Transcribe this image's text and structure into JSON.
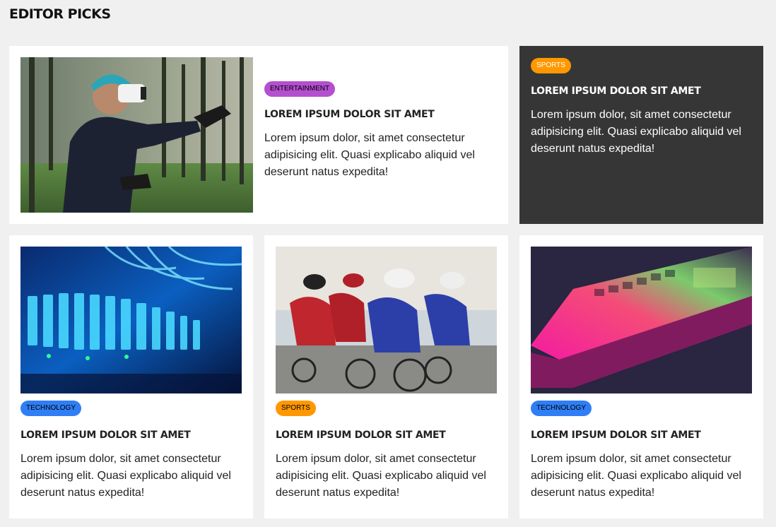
{
  "section": {
    "title": "EDITOR PICKS"
  },
  "colors": {
    "entertainment": "#b44fd0",
    "sports": "#ff9800",
    "technology": "#2f7ef5",
    "dark_card": "#363636"
  },
  "cards": [
    {
      "category": "ENTERTAINMENT",
      "badge_color": "#b44fd0",
      "title": "LOREM IPSUM DOLOR SIT AMET",
      "text": "Lorem ipsum dolor, sit amet consectetur adipisicing elit. Quasi explicabo aliquid vel deserunt natus expedita!",
      "image_icon": "vr-headset-photo"
    },
    {
      "category": "SPORTS",
      "badge_color": "#ff9800",
      "title": "LOREM IPSUM DOLOR SIT AMET",
      "text": "Lorem ipsum dolor, sit amet consectetur adipisicing elit. Quasi explicabo aliquid vel deserunt natus expedita!"
    },
    {
      "category": "TECHNOLOGY",
      "badge_color": "#2f7ef5",
      "title": "LOREM IPSUM DOLOR SIT AMET",
      "text": "Lorem ipsum dolor, sit amet consectetur adipisicing elit. Quasi explicabo aliquid vel deserunt natus expedita!",
      "image_icon": "server-rack-photo"
    },
    {
      "category": "SPORTS",
      "badge_color": "#ff9800",
      "title": "LOREM IPSUM DOLOR SIT AMET",
      "text": "Lorem ipsum dolor, sit amet consectetur adipisicing elit. Quasi explicabo aliquid vel deserunt natus expedita!",
      "image_icon": "cyclists-photo"
    },
    {
      "category": "TECHNOLOGY",
      "badge_color": "#2f7ef5",
      "title": "LOREM IPSUM DOLOR SIT AMET",
      "text": "Lorem ipsum dolor, sit amet consectetur adipisicing elit. Quasi explicabo aliquid vel deserunt natus expedita!",
      "image_icon": "laptop-keyboard-photo"
    }
  ]
}
